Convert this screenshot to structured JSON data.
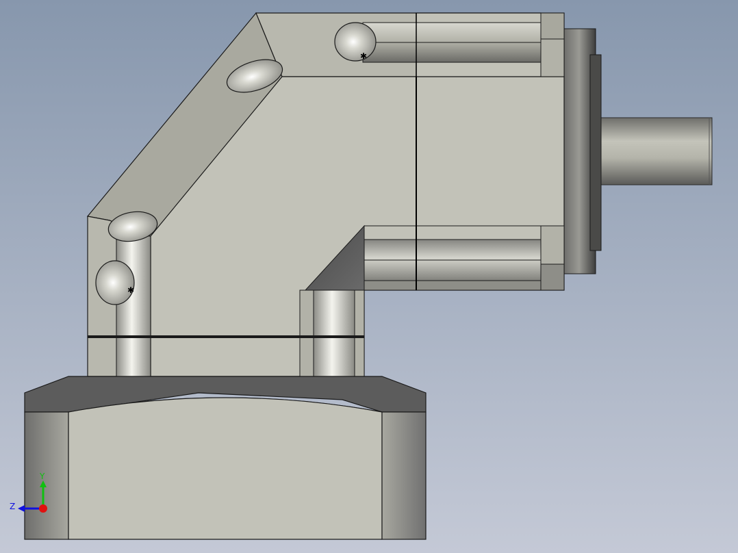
{
  "viewport": {
    "background_top": "#8797ad",
    "background_bottom": "#c4c9d6"
  },
  "colors": {
    "body_light": "#c2c2b8",
    "body_mid": "#a9a99f",
    "body_dark": "#5c5c5c",
    "edge": "#1a1a1a",
    "flange_dark": "#3a3a3a"
  },
  "triad": {
    "y_label": "Y",
    "z_label": "Z",
    "x_color": "#e01010",
    "y_color": "#10c010",
    "z_color": "#1010e0"
  }
}
